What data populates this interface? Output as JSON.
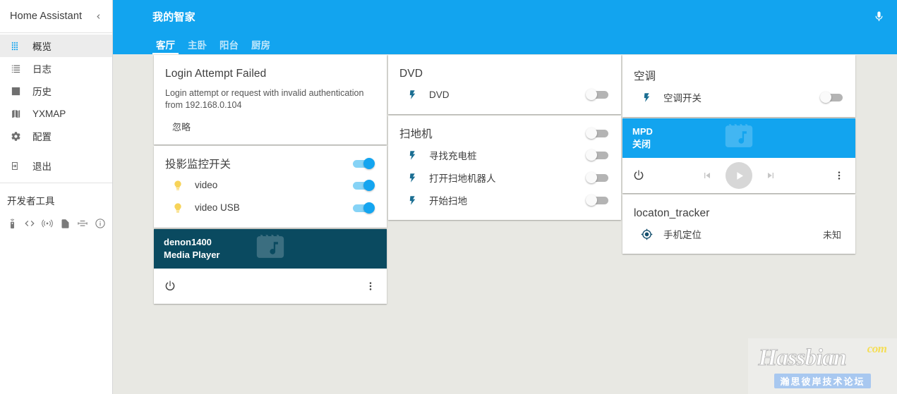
{
  "sidebar": {
    "title": "Home Assistant",
    "collapse_icon": "chevron-left-icon",
    "items": [
      {
        "label": "概览",
        "icon": "grid-icon",
        "active": true
      },
      {
        "label": "日志",
        "icon": "list-icon",
        "active": false
      },
      {
        "label": "历史",
        "icon": "chart-bar-icon",
        "active": false
      },
      {
        "label": "YXMAP",
        "icon": "map-icon",
        "active": false
      },
      {
        "label": "配置",
        "icon": "gear-icon",
        "active": false
      },
      {
        "label": "退出",
        "icon": "logout-icon",
        "active": false
      }
    ],
    "dev_tools_title": "开发者工具",
    "dev_tools_icons": [
      "remote-icon",
      "code-icon",
      "broadcast-icon",
      "file-code-icon",
      "template-icon",
      "info-icon"
    ]
  },
  "header": {
    "title": "我的智家",
    "mic_icon": "microphone-icon",
    "tabs": [
      {
        "label": "客厅",
        "active": true
      },
      {
        "label": "主卧",
        "active": false
      },
      {
        "label": "阳台",
        "active": false
      },
      {
        "label": "厨房",
        "active": false
      }
    ]
  },
  "colors": {
    "accent": "#12A4EF",
    "toggle_on_track": "#86D3F6",
    "toggle_on_thumb": "#14A5F0",
    "toggle_off_track": "#B4B4B4",
    "media_card_teal": "#0A4A60",
    "media_card_blue": "#12A4EF",
    "content_bg": "#E8E8E3",
    "lightbulb_amber": "#F7D358"
  },
  "cards": {
    "login_failed": {
      "title": "Login Attempt Failed",
      "body": "Login attempt or request with invalid authentication from 192.168.0.104",
      "dismiss_label": "忽略"
    },
    "projector": {
      "title": "投影监控开关",
      "master_state": "on",
      "rows": [
        {
          "label": "video",
          "icon": "lightbulb-icon",
          "state": "on"
        },
        {
          "label": "video USB",
          "icon": "lightbulb-icon",
          "state": "on"
        }
      ]
    },
    "denon": {
      "name": "denon1400",
      "state": "Media Player",
      "artwork_icon": "music-album-icon",
      "power_icon": "power-icon",
      "menu_icon": "dots-vertical-icon"
    },
    "dvd": {
      "title": "DVD",
      "rows": [
        {
          "label": "DVD",
          "icon": "flash-icon",
          "state": "off"
        }
      ]
    },
    "vacuum": {
      "title": "扫地机",
      "master_state": "off",
      "rows": [
        {
          "label": "寻找充电桩",
          "icon": "flash-icon",
          "state": "off"
        },
        {
          "label": "打开扫地机器人",
          "icon": "flash-icon",
          "state": "off"
        },
        {
          "label": "开始扫地",
          "icon": "flash-icon",
          "state": "off"
        }
      ]
    },
    "aircon": {
      "title": "空调",
      "rows": [
        {
          "label": "空调开关",
          "icon": "flash-icon",
          "state": "off"
        }
      ]
    },
    "mpd": {
      "name": "MPD",
      "state": "关闭",
      "artwork_icon": "music-album-icon",
      "power_icon": "power-icon",
      "prev_icon": "skip-previous-icon",
      "play_icon": "play-icon",
      "next_icon": "skip-next-icon",
      "menu_icon": "dots-vertical-icon"
    },
    "location": {
      "title": "locaton_tracker",
      "rows": [
        {
          "label": "手机定位",
          "icon": "crosshairs-gps-icon",
          "value": "未知"
        }
      ]
    }
  },
  "watermark": {
    "brand": "Hassbian",
    "tld": "com",
    "subtitle": "瀚思彼岸技术论坛"
  }
}
